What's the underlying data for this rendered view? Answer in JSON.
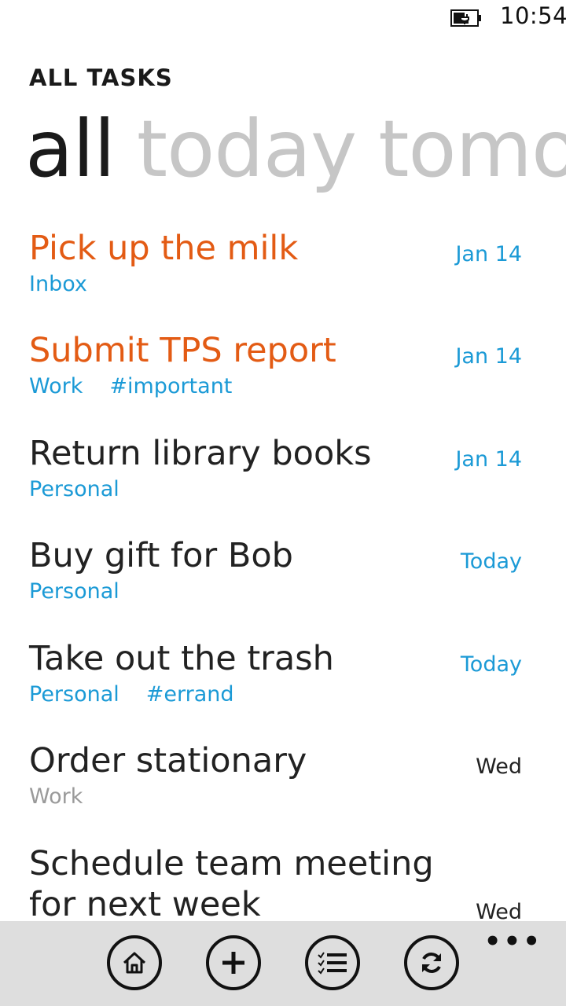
{
  "status_bar": {
    "time": "10:54",
    "battery_icon": "battery-charging-icon"
  },
  "app_title": "ALL TASKS",
  "pivot": {
    "items": [
      "all",
      "today",
      "tomo"
    ],
    "active_index": 0
  },
  "tasks": [
    {
      "title": "Pick up the milk",
      "list": "Inbox",
      "tags": [],
      "due": "Jan 14",
      "overdue": true
    },
    {
      "title": "Submit TPS report",
      "list": "Work",
      "tags": [
        "#important"
      ],
      "due": "Jan 14",
      "overdue": true
    },
    {
      "title": "Return library books",
      "list": "Personal",
      "tags": [],
      "due": "Jan 14",
      "overdue": false
    },
    {
      "title": "Buy gift for Bob",
      "list": "Personal",
      "tags": [],
      "due": "Today",
      "overdue": false
    },
    {
      "title": "Take out the trash",
      "list": "Personal",
      "tags": [
        "#errand"
      ],
      "due": "Today",
      "overdue": false
    },
    {
      "title": "Order stationary",
      "list": "Work",
      "tags": [],
      "due": "Wed",
      "overdue": false
    },
    {
      "title": "Schedule team meeting for next week",
      "list": "",
      "tags": [],
      "due": "Wed",
      "overdue": false
    }
  ],
  "app_bar": {
    "buttons": [
      "home-icon",
      "add-icon",
      "list-icon",
      "sync-icon"
    ],
    "more": "•••"
  },
  "colors": {
    "overdue": "#e35b14",
    "accent": "#1b9ad6",
    "inactive_pivot": "#c6c6c6",
    "app_bar_bg": "#dedede"
  }
}
